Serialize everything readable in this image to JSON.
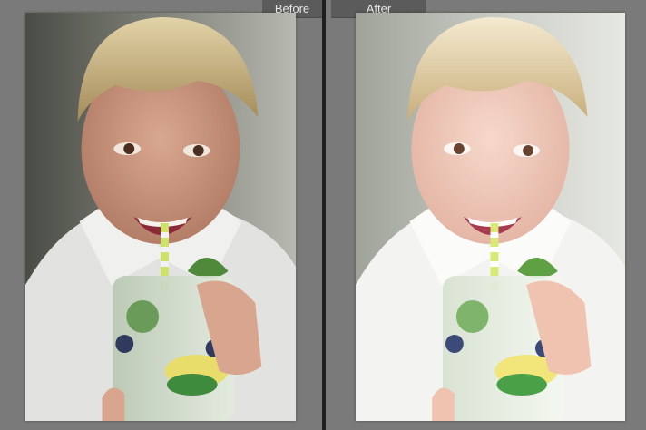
{
  "view": {
    "before_label": "Before",
    "after_label": "After"
  },
  "photos": {
    "before": {
      "description_icon": "portrait-photo-icon"
    },
    "after": {
      "description_icon": "portrait-photo-icon"
    }
  },
  "colors": {
    "panel_bg": "#777777",
    "label_bg": "#5b5b5b",
    "label_text": "#e6e6e6",
    "divider": "#1e1e1e"
  }
}
